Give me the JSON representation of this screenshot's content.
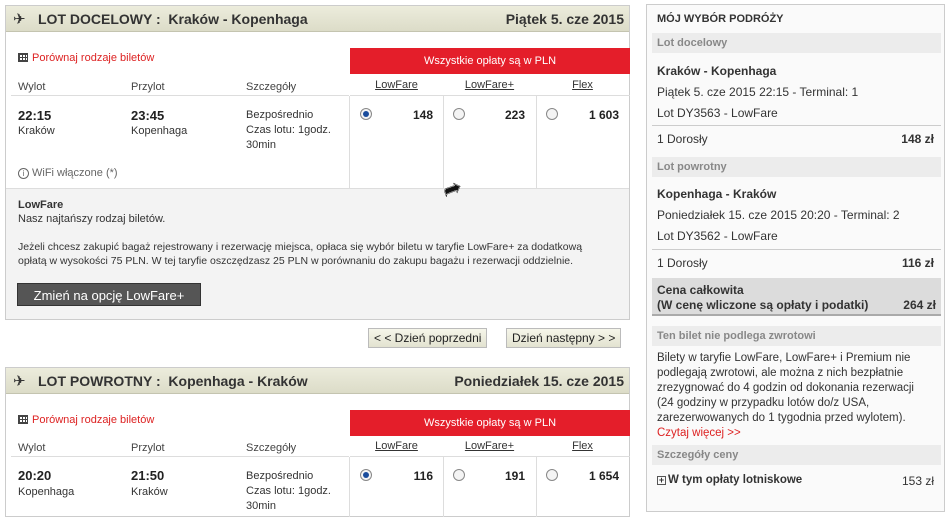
{
  "outbound": {
    "title": "LOT DOCELOWY :  Kraków - Kopenhaga",
    "date": "Piątek 5. cze 2015",
    "compare": "Porównaj rodzaje biletów",
    "fees_banner": "Wszystkie opłaty są w PLN",
    "col_departure": "Wylot",
    "col_arrival": "Przylot",
    "col_details": "Szczegóły",
    "fares": [
      "LowFare",
      "LowFare+",
      "Flex"
    ],
    "dep_time": "22:15",
    "dep_city": "Kraków",
    "arr_time": "23:45",
    "arr_city": "Kopenhaga",
    "details": {
      "direct": "Bezpośrednio",
      "duration": "Czas lotu: 1godz.",
      "duration2": "30min"
    },
    "prices": [
      "148",
      "223",
      "1 603"
    ],
    "selected_fare": 0,
    "wifi": "WiFi włączone (*)",
    "info_title": "LowFare",
    "info_sub": "Nasz najtańszy rodzaj biletów.",
    "info_text1": "Jeżeli chcesz zakupić bagaż rejestrowany i rezerwację miejsca, opłaca się wybór biletu w taryfie LowFare+ za dodatkową",
    "info_text2": "opłatą w wysokości 75 PLN. W tej taryfie oszczędzasz 25 PLN w porównaniu do zakupu bagażu i rezerwacji oddzielnie.",
    "upgrade_button": "Zmień na opcję LowFare+"
  },
  "nav": {
    "prev": "< < Dzień poprzedni",
    "next": "Dzień następny > >"
  },
  "inbound": {
    "title": "LOT POWROTNY :  Kopenhaga - Kraków",
    "date": "Poniedziałek 15. cze 2015",
    "compare": "Porównaj rodzaje biletów",
    "fees_banner": "Wszystkie opłaty są w PLN",
    "col_departure": "Wylot",
    "col_arrival": "Przylot",
    "col_details": "Szczegóły",
    "fares": [
      "LowFare",
      "LowFare+",
      "Flex"
    ],
    "dep_time": "20:20",
    "dep_city": "Kopenhaga",
    "arr_time": "21:50",
    "arr_city": "Kraków",
    "details": {
      "direct": "Bezpośrednio",
      "duration": "Czas lotu: 1godz.",
      "duration2": "30min"
    },
    "prices": [
      "116",
      "191",
      "1 654"
    ],
    "selected_fare": 0
  },
  "summary": {
    "title": "MÓJ WYBÓR PODRÓŻY",
    "out_section": "Lot docelowy",
    "out_route": "Kraków - Kopenhaga",
    "out_time": "Piątek 5. cze 2015 22:15 - Terminal: 1",
    "out_flight": "Lot DY3563 - LowFare",
    "out_pax": "1 Dorosły",
    "out_price": "148 zł",
    "ret_section": "Lot powrotny",
    "ret_route": "Kopenhaga - Kraków",
    "ret_time": "Poniedziałek 15. cze 2015 20:20 - Terminal: 2",
    "ret_flight": "Lot DY3562 - LowFare",
    "ret_pax": "1 Dorosły",
    "ret_price": "116 zł",
    "total_label": "Cena całkowita",
    "total_sub": "(W cenę wliczone są opłaty i podatki)",
    "total_price": "264 zł",
    "refund_section": "Ten bilet nie podlega zwrotowi",
    "refund_lines": [
      "Bilety w taryfie LowFare, LowFare+ i Premium nie",
      "podlegają zwrotowi, ale można z nich bezpłatnie",
      "zrezygnować do 4 godzin od dokonania rezerwacji",
      "(24 godziny w przypadku lotów do/z USA,",
      "zarezerwowanych do 1 tygodnia przed wylotem)."
    ],
    "read_more": "Czytaj więcej >>",
    "price_details_section": "Szczegóły ceny",
    "airport_fees_label": "W tym opłaty lotniskowe",
    "airport_fees": "153 zł"
  },
  "colors": {
    "accent_red": "#e41e2a",
    "radio_selected": "#1a4c9c"
  }
}
